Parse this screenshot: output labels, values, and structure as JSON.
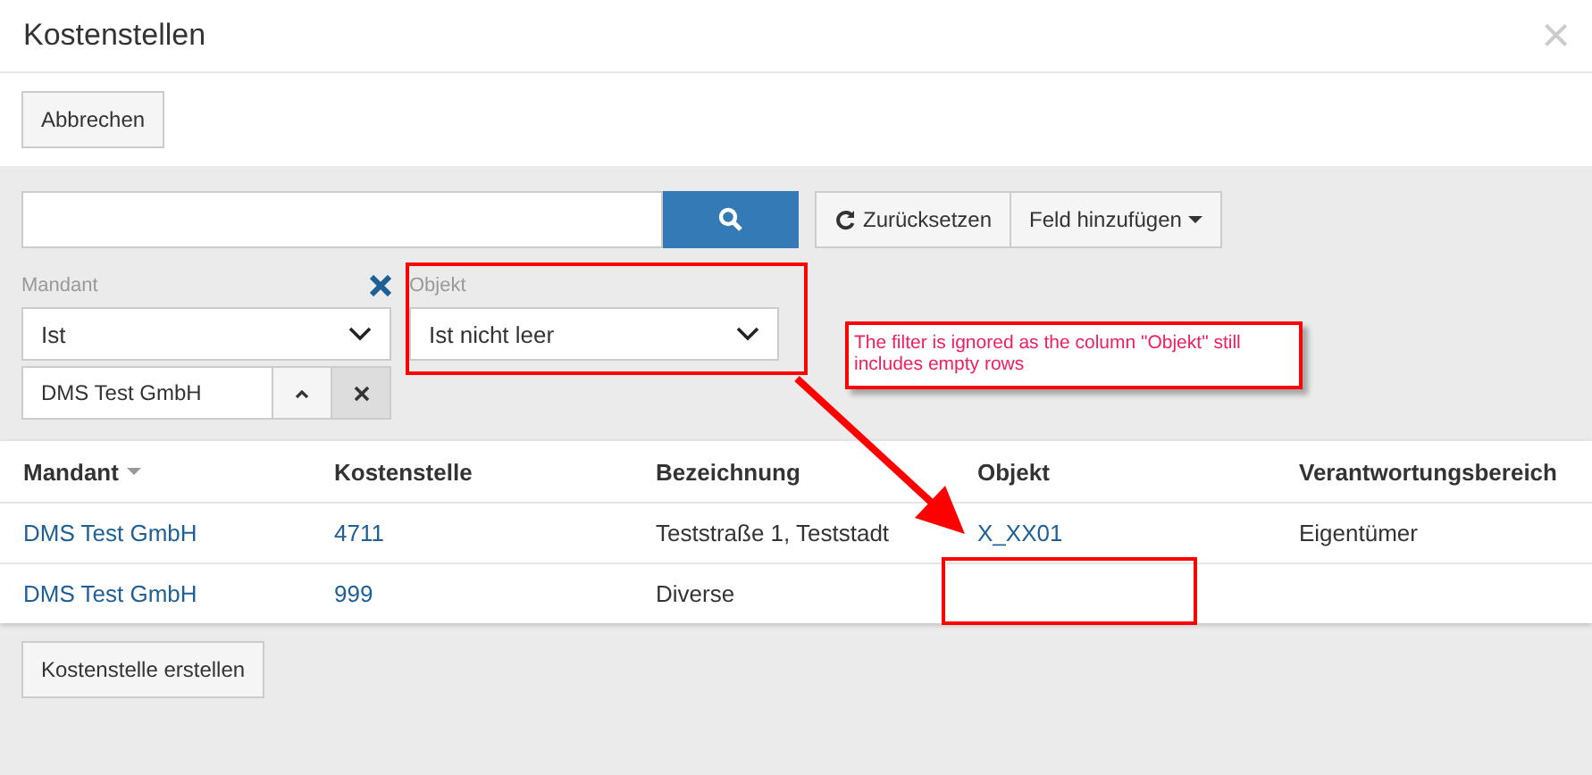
{
  "window": {
    "title": "Kostenstellen",
    "close": "×"
  },
  "toolbar": {
    "cancel": "Abbrechen"
  },
  "search": {
    "reset": "Zurücksetzen",
    "add_field": "Feld hinzufügen"
  },
  "filters": [
    {
      "label": "Mandant",
      "operator": "Ist",
      "value": "DMS Test GmbH",
      "removable": true
    },
    {
      "label": "Objekt",
      "operator": "Ist nicht leer",
      "highlighted": true
    }
  ],
  "table": {
    "columns": [
      {
        "label": "Mandant",
        "sorted": true
      },
      {
        "label": "Kostenstelle",
        "sorted": false
      },
      {
        "label": "Bezeichnung",
        "sorted": false
      },
      {
        "label": "Objekt",
        "sorted": false
      },
      {
        "label": "Verantwortungsbereich",
        "sorted": false
      }
    ],
    "rows": [
      {
        "cells": [
          {
            "text": "DMS Test GmbH",
            "link": true
          },
          {
            "text": "4711",
            "link": true
          },
          {
            "text": "Teststraße 1, Teststadt",
            "link": false
          },
          {
            "text": "X_XX01",
            "link": true
          },
          {
            "text": "Eigentümer",
            "link": false
          }
        ]
      },
      {
        "cells": [
          {
            "text": "DMS Test GmbH",
            "link": true
          },
          {
            "text": "999",
            "link": true
          },
          {
            "text": "Diverse",
            "link": false
          },
          {
            "text": "",
            "highlighted": true
          },
          {
            "text": ""
          }
        ]
      }
    ]
  },
  "create_button": "Kostenstelle erstellen",
  "annotation": {
    "text": "The filter is ignored as the column \"Objekt\" still includes empty rows"
  }
}
